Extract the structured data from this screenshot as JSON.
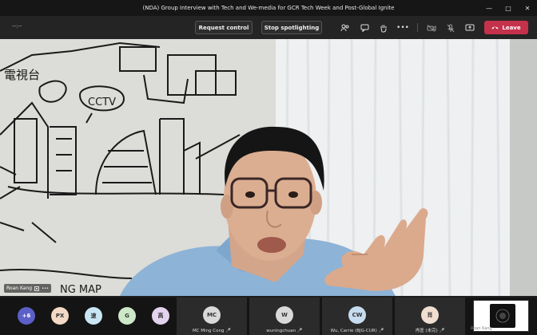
{
  "window": {
    "title": "(NDA) Group Interview with Tech and We-media for GCR Tech Week and Post-Global Ignite",
    "controls": [
      "minimize-icon",
      "maximize-icon",
      "close-icon"
    ]
  },
  "toolbar": {
    "timer": "--:--",
    "request_control_label": "Request control",
    "stop_spotlighting_label": "Stop spotlighting",
    "icons": [
      "people-icon",
      "chat-icon",
      "raise-hand-icon",
      "more-icon",
      "camera-off-icon",
      "mic-off-icon",
      "share-icon"
    ],
    "leave_label": "Leave"
  },
  "stage": {
    "speaker_name": "Roan Kang",
    "wall_text": [
      "CCTV",
      "電視台",
      "NG MAP"
    ]
  },
  "participants": {
    "overflow_count": "+6",
    "avatars": [
      {
        "initials": "PX",
        "color": "#f3d9c6"
      },
      {
        "initials": "速",
        "color": "#c9e6f5"
      },
      {
        "initials": "G",
        "color": "#cde8c8"
      },
      {
        "initials": "高",
        "color": "#e3d3ef"
      }
    ],
    "tiles": [
      {
        "initials": "MC",
        "name": "MC Ming Cong",
        "color": "#d9d9d9"
      },
      {
        "initials": "W",
        "name": "wuningchuan",
        "color": "#d9d9d9"
      },
      {
        "initials": "CW",
        "name": "Wu, Carrie (BJG-CUR)",
        "color": "#c7dcef"
      },
      {
        "initials": "肖",
        "name": "肖医 (未完)",
        "color": "#f0ded0"
      }
    ],
    "self_name": "Roan Kang"
  },
  "colors": {
    "leave": "#c4314b",
    "titlebar": "#161616",
    "toolbar": "#242424"
  }
}
